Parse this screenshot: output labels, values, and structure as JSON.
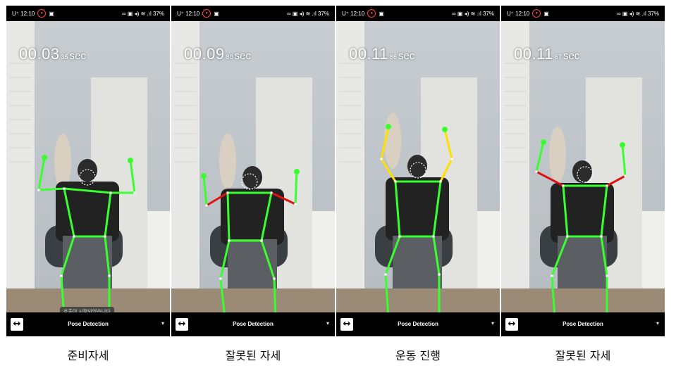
{
  "status": {
    "carrier": "U⁺ 12:10",
    "right_text": "37%"
  },
  "mode_label": "Pose Detection",
  "toast_text": "호출이 시작되었습니다",
  "colors": {
    "ok": "#39ff2e",
    "wrong": "#e01010",
    "warn": "#ffe000",
    "point": "#39ff2e"
  },
  "panels": [
    {
      "timer_main": "00.03",
      "timer_frac": "35",
      "timer_unit": "sec",
      "caption": "준비자세"
    },
    {
      "timer_main": "00.09",
      "timer_frac": "80",
      "timer_unit": "sec",
      "caption": "잘못된 자세"
    },
    {
      "timer_main": "00.11",
      "timer_frac": "86",
      "timer_unit": "sec",
      "caption": "운동 진행"
    },
    {
      "timer_main": "00.11",
      "timer_frac": "67",
      "timer_unit": "sec",
      "caption": "잘못된 자세"
    }
  ]
}
